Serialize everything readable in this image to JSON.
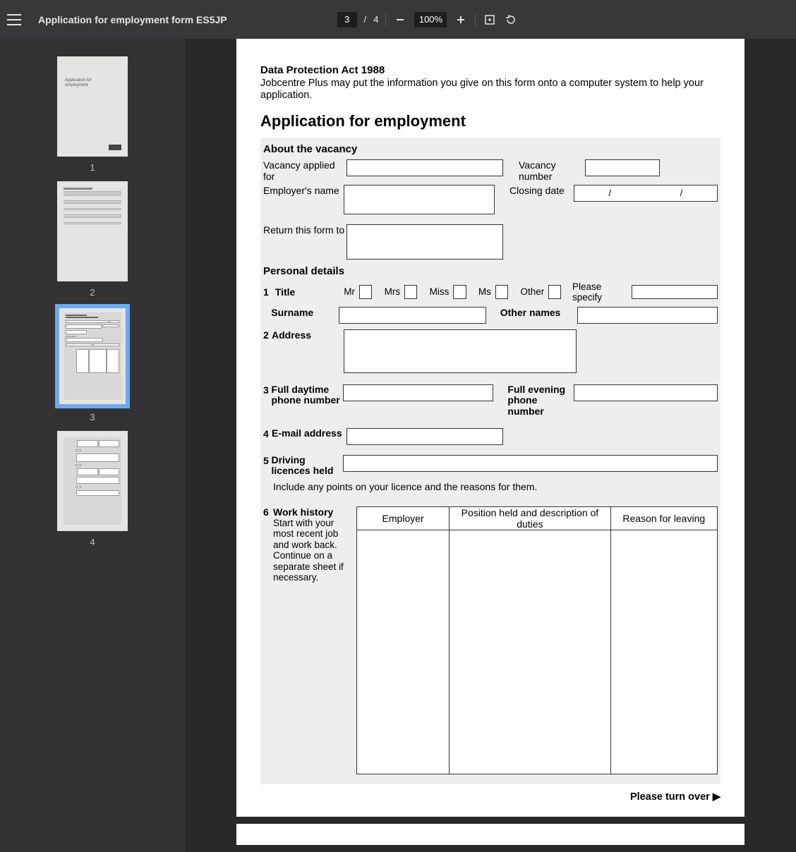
{
  "toolbar": {
    "title": "Application for employment form ES5JP",
    "page_current": "3",
    "page_sep": "/",
    "page_total": "4",
    "zoom": "100%"
  },
  "thumbs": [
    "1",
    "2",
    "3",
    "4"
  ],
  "thumb1_title": "Application for employment",
  "doc": {
    "dp_title": "Data Protection Act 1988",
    "dp_body": "Jobcentre Plus may put the information you give on this form onto a computer system to help your application.",
    "app_title": "Application for employment",
    "sec_vacancy": "About the vacancy",
    "vac_applied": "Vacancy applied for",
    "vac_number": "Vacancy number",
    "emp_name": "Employer's name",
    "closing": "Closing date",
    "date_sep": "/",
    "return": "Return this form to",
    "sec_personal": "Personal details",
    "q1": "1",
    "q1_title": "Title",
    "t_mr": "Mr",
    "t_mrs": "Mrs",
    "t_miss": "Miss",
    "t_ms": "Ms",
    "t_other": "Other",
    "t_spec": "Please specify",
    "surname": "Surname",
    "other_names": "Other names",
    "q2": "2",
    "q2_addr": "Address",
    "q3": "3",
    "q3_day": "Full daytime phone number",
    "q3_eve": "Full evening phone number",
    "q4": "4",
    "q4_email": "E-mail address",
    "q5": "5",
    "q5_dl": "Driving licences held",
    "q5_sub": "Include any points on your licence and the reasons for them.",
    "q6": "6",
    "q6_wh": "Work history",
    "q6_sub": "Start with your most recent job and work back. Continue on a separate sheet if necessary.",
    "wh_c1": "Employer",
    "wh_c2": "Position held and description of duties",
    "wh_c3": "Reason for leaving",
    "turnover": "Please turn over  ▶"
  }
}
